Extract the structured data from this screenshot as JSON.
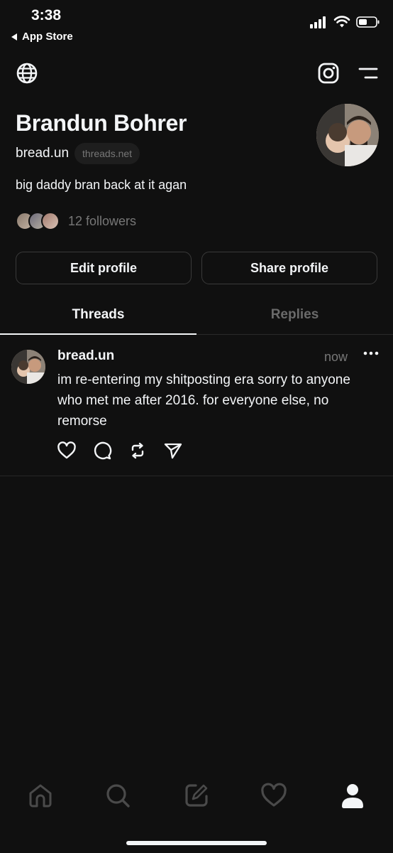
{
  "status_bar": {
    "time": "3:38",
    "back_label": "App Store"
  },
  "top_nav": {
    "left_icon": "globe-icon",
    "right_icons": [
      "instagram-icon",
      "menu-icon"
    ]
  },
  "profile": {
    "name": "Brandun Bohrer",
    "handle": "bread.un",
    "domain_badge": "threads.net",
    "bio": "big daddy bran back at it agan",
    "followers_text": "12 followers"
  },
  "buttons": {
    "edit_profile": "Edit profile",
    "share_profile": "Share profile"
  },
  "tabs": [
    {
      "label": "Threads",
      "active": true
    },
    {
      "label": "Replies",
      "active": false
    }
  ],
  "post": {
    "username": "bread.un",
    "time": "now",
    "text": "im re-entering my shitposting era sorry to anyone who met me after 2016. for everyone else, no remorse",
    "actions": [
      "heart-icon",
      "comment-icon",
      "repost-icon",
      "send-icon"
    ]
  },
  "bottom_nav": {
    "items": [
      "home-icon",
      "search-icon",
      "compose-icon",
      "activity-heart-icon",
      "profile-icon"
    ],
    "active": "profile-icon"
  },
  "colors": {
    "background": "#101010",
    "text_primary": "#f3f5f7",
    "text_secondary": "#777777",
    "border": "#3a3a3a"
  }
}
